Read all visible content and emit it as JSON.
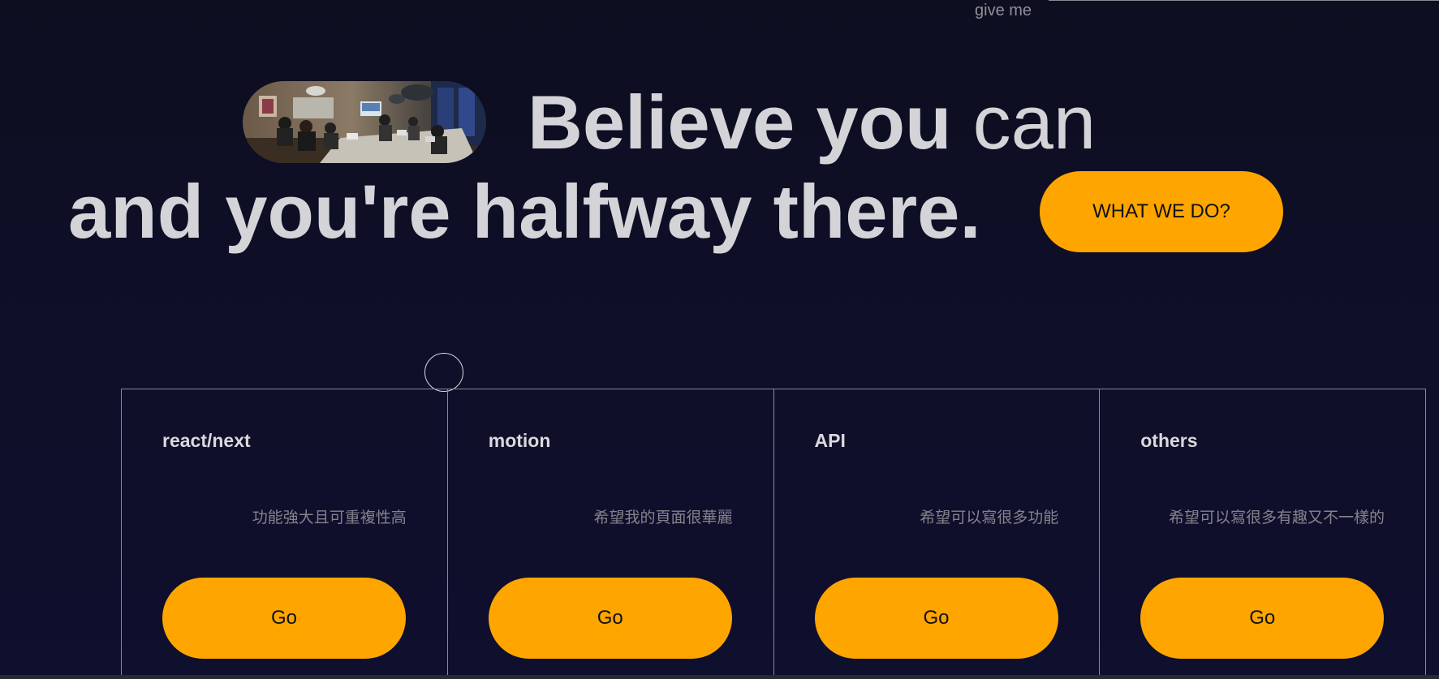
{
  "header": {
    "give_me": "give me"
  },
  "hero": {
    "line1_bold": "Believe you",
    "line1_light": "can",
    "line2": "and you're halfway there.",
    "cta_label": "WHAT WE DO?",
    "photo_description": "team-meeting-photo"
  },
  "cards": [
    {
      "title": "react/next",
      "desc": "功能強大且可重複性高",
      "button": "Go"
    },
    {
      "title": "motion",
      "desc": "希望我的頁面很華麗",
      "button": "Go"
    },
    {
      "title": "API",
      "desc": "希望可以寫很多功能",
      "button": "Go"
    },
    {
      "title": "others",
      "desc": "希望可以寫很多有趣又不一樣的",
      "button": "Go"
    }
  ],
  "colors": {
    "accent": "#ffa500",
    "background": "#0f0f2a",
    "text": "#d4d4d8",
    "muted": "#83838d"
  }
}
